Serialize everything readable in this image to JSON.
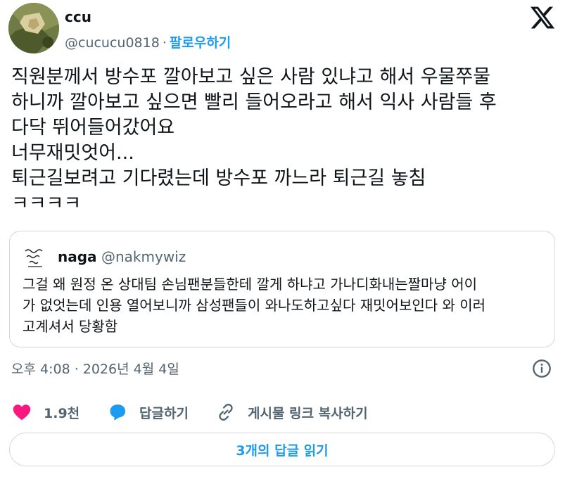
{
  "author": {
    "name": "ccu",
    "handle": "@cucucu0818",
    "separator": "·",
    "follow_label": "팔로우하기"
  },
  "tweet": {
    "text": "직원분께서 방수포 깔아보고 싶은 사람 있냐고 해서 우물쭈물\n하니까 깔아보고 싶으면 빨리 들어오라고 해서 익사 사람들 후\n다닥 뛰어들어갔어요\n너무재밋엇어...\n퇴근길보려고 기다렸는데 방수포 까느라 퇴근길 놓침\nㅋㅋㅋㅋ"
  },
  "quote": {
    "name": "naga",
    "handle": "@nakmywiz",
    "text": "그걸 왜 원정 온 상대팀 손님팬분들한테 깔게 하냐고 가나디화내는짤마냥 어이\n가 없엇는데 인용 열어보니까 삼성팬들이 와나도하고싶다 재밋어보인다 와 이러\n고계셔서 당황함"
  },
  "meta": {
    "timestamp": "오후 4:08 · 2026년 4월 4일"
  },
  "actions": {
    "like_count": "1.9천",
    "reply_label": "답글하기",
    "copy_link_label": "게시물 링크 복사하기"
  },
  "replies_button_label": "3개의 답글 읽기",
  "colors": {
    "accent": "#1d9bf0",
    "like": "#f91880",
    "text": "#0f1419",
    "muted": "#536471",
    "border": "#cfd9de"
  }
}
